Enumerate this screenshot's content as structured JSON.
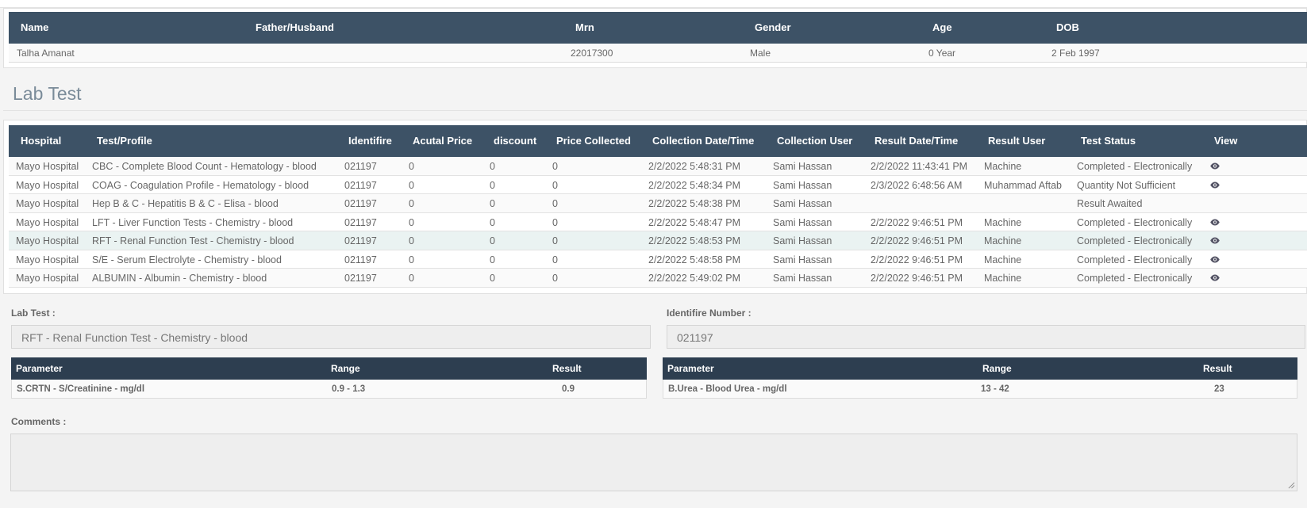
{
  "patient": {
    "headers": {
      "name": "Name",
      "father": "Father/Husband",
      "mrn": "Mrn",
      "gender": "Gender",
      "age": "Age",
      "dob": "DOB"
    },
    "values": {
      "name": "Talha Amanat",
      "father": "",
      "mrn": "22017300",
      "gender": "Male",
      "age": "0 Year",
      "dob": "2 Feb 1997"
    }
  },
  "section_title": "Lab Test",
  "tests": {
    "headers": {
      "hospital": "Hospital",
      "test": "Test/Profile",
      "identifire": "Identifire",
      "actual_price": "Acutal Price",
      "discount": "discount",
      "price_collected": "Price Collected",
      "collection_datetime": "Collection Date/Time",
      "collection_user": "Collection User",
      "result_datetime": "Result Date/Time",
      "result_user": "Result User",
      "status": "Test Status",
      "view": "View"
    },
    "rows": [
      {
        "hospital": "Mayo Hospital",
        "test": "CBC - Complete Blood Count - Hematology - blood",
        "identifire": "021197",
        "actual_price": "0",
        "discount": "0",
        "price_collected": "0",
        "collection_datetime": "2/2/2022 5:48:31 PM",
        "collection_user": "Sami Hassan",
        "result_datetime": "2/2/2022 11:43:41 PM",
        "result_user": "Machine",
        "status": "Completed - Electronically",
        "view_icon": "eye-icon"
      },
      {
        "hospital": "Mayo Hospital",
        "test": "COAG - Coagulation Profile - Hematology - blood",
        "identifire": "021197",
        "actual_price": "0",
        "discount": "0",
        "price_collected": "0",
        "collection_datetime": "2/2/2022 5:48:34 PM",
        "collection_user": "Sami Hassan",
        "result_datetime": "2/3/2022 6:48:56 AM",
        "result_user": "Muhammad Aftab",
        "status": "Quantity Not Sufficient",
        "view_icon": "eye-icon"
      },
      {
        "hospital": "Mayo Hospital",
        "test": "Hep B & C - Hepatitis B & C - Elisa - blood",
        "identifire": "021197",
        "actual_price": "0",
        "discount": "0",
        "price_collected": "0",
        "collection_datetime": "2/2/2022 5:48:38 PM",
        "collection_user": "Sami Hassan",
        "result_datetime": "",
        "result_user": "",
        "status": "Result Awaited",
        "view_icon": ""
      },
      {
        "hospital": "Mayo Hospital",
        "test": "LFT - Liver Function Tests - Chemistry - blood",
        "identifire": "021197",
        "actual_price": "0",
        "discount": "0",
        "price_collected": "0",
        "collection_datetime": "2/2/2022 5:48:47 PM",
        "collection_user": "Sami Hassan",
        "result_datetime": "2/2/2022 9:46:51 PM",
        "result_user": "Machine",
        "status": "Completed - Electronically",
        "view_icon": "eye-icon"
      },
      {
        "hospital": "Mayo Hospital",
        "test": "RFT - Renal Function Test - Chemistry - blood",
        "identifire": "021197",
        "actual_price": "0",
        "discount": "0",
        "price_collected": "0",
        "collection_datetime": "2/2/2022 5:48:53 PM",
        "collection_user": "Sami Hassan",
        "result_datetime": "2/2/2022 9:46:51 PM",
        "result_user": "Machine",
        "status": "Completed - Electronically",
        "view_icon": "eye-icon"
      },
      {
        "hospital": "Mayo Hospital",
        "test": "S/E - Serum Electrolyte - Chemistry - blood",
        "identifire": "021197",
        "actual_price": "0",
        "discount": "0",
        "price_collected": "0",
        "collection_datetime": "2/2/2022 5:48:58 PM",
        "collection_user": "Sami Hassan",
        "result_datetime": "2/2/2022 9:46:51 PM",
        "result_user": "Machine",
        "status": "Completed - Electronically",
        "view_icon": "eye-icon"
      },
      {
        "hospital": "Mayo Hospital",
        "test": "ALBUMIN - Albumin - Chemistry - blood",
        "identifire": "021197",
        "actual_price": "0",
        "discount": "0",
        "price_collected": "0",
        "collection_datetime": "2/2/2022 5:49:02 PM",
        "collection_user": "Sami Hassan",
        "result_datetime": "2/2/2022 9:46:51 PM",
        "result_user": "Machine",
        "status": "Completed - Electronically",
        "view_icon": "eye-icon"
      }
    ]
  },
  "details": {
    "lab_test_label": "Lab Test :",
    "lab_test_value": "RFT - Renal Function Test - Chemistry - blood",
    "identifire_label": "Identifire Number :",
    "identifire_value": "021197",
    "param_headers": {
      "parameter": "Parameter",
      "range": "Range",
      "result": "Result"
    },
    "left_params": [
      {
        "parameter": "S.CRTN - S/Creatinine - mg/dl",
        "range": "0.9 - 1.3",
        "result": "0.9"
      }
    ],
    "right_params": [
      {
        "parameter": "B.Urea - Blood Urea - mg/dl",
        "range": "13 - 42",
        "result": "23"
      }
    ],
    "comments_label": "Comments :",
    "comments_value": ""
  },
  "colors": {
    "header_bg": "#3d5266",
    "param_header_bg": "#2d3e50",
    "highlight_row": "#eaf3f2"
  }
}
